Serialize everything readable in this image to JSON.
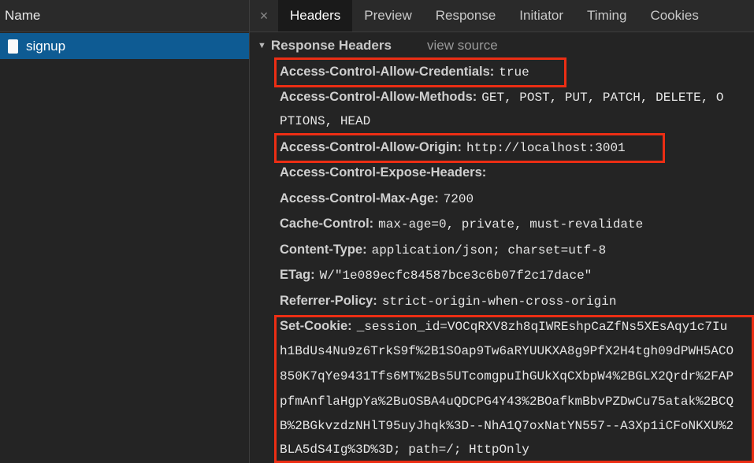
{
  "left_panel": {
    "header": "Name",
    "request": {
      "name": "signup",
      "icon": "document-icon"
    }
  },
  "tabs": {
    "close": "×",
    "items": [
      "Headers",
      "Preview",
      "Response",
      "Initiator",
      "Timing",
      "Cookies"
    ],
    "active": "Headers"
  },
  "section": {
    "toggle": "▼",
    "title": "Response Headers",
    "view_source": "view source"
  },
  "headers": [
    {
      "name": "Access-Control-Allow-Credentials:",
      "value": "true",
      "highlighted": true
    },
    {
      "name": "Access-Control-Allow-Methods:",
      "value": "GET, POST, PUT, PATCH, DELETE, O",
      "continuation": "PTIONS, HEAD"
    },
    {
      "name": "Access-Control-Allow-Origin:",
      "value": "http://localhost:3001",
      "highlighted": true
    },
    {
      "name": "Access-Control-Expose-Headers:",
      "value": ""
    },
    {
      "name": "Access-Control-Max-Age:",
      "value": "7200"
    },
    {
      "name": "Cache-Control:",
      "value": "max-age=0, private, must-revalidate"
    },
    {
      "name": "Content-Type:",
      "value": "application/json; charset=utf-8"
    },
    {
      "name": "ETag:",
      "value": "W/\"1e089ecfc84587bce3c6b07f2c17dace\""
    },
    {
      "name": "Referrer-Policy:",
      "value": "strict-origin-when-cross-origin"
    },
    {
      "name": "Set-Cookie:",
      "value": "_session_id=VOCqRXV8zh8qIWREshpCaZfNs5XEsAqy1c7Iu",
      "highlighted": true,
      "continuation": [
        "h1BdUs4Nu9z6TrkS9f%2B1SOap9Tw6aRYUUKXA8g9PfX2H4tgh09dPWH5ACO",
        "850K7qYe9431Tfs6MT%2Bs5UTcomgpuIhGUkXqCXbpW4%2BGLX2Qrdr%2FAP",
        "pfmAnflaHgpYa%2BuOSBA4uQDCPG4Y43%2BOafkmBbvPZDwCu75atak%2BCQ",
        "B%2BGkvzdzNHlT95uyJhqk%3D--NhA1Q7oxNatYN557--A3Xp1iCFoNKXU%2",
        "BLA5dS4Ig%3D%3D; path=/; HttpOnly"
      ]
    }
  ],
  "colors": {
    "highlight": "#ec2e14",
    "selected_row": "#0e5b93",
    "background": "#242424"
  }
}
